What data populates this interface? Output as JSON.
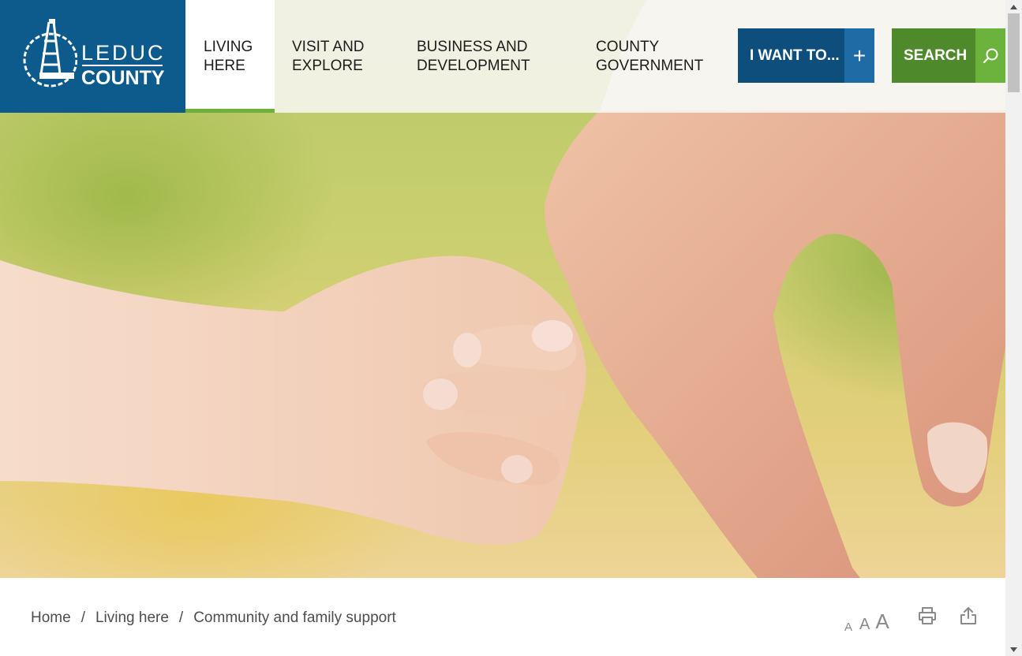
{
  "header": {
    "logo": {
      "line1": "LEDUC",
      "line2": "COUNTY"
    },
    "nav": [
      {
        "line1": "LIVING",
        "line2": "HERE",
        "active": true
      },
      {
        "line1": "VISIT AND",
        "line2": "EXPLORE",
        "active": false
      },
      {
        "line1": "BUSINESS AND",
        "line2": "DEVELOPMENT",
        "active": false
      },
      {
        "line1": "COUNTY",
        "line2": "GOVERNMENT",
        "active": false
      }
    ],
    "i_want_button": {
      "label": "I WANT TO...",
      "icon": "plus-icon"
    },
    "search_button": {
      "label": "SEARCH",
      "icon": "search-icon"
    }
  },
  "breadcrumb": {
    "items": [
      "Home",
      "Living here",
      "Community and family support"
    ],
    "separator": "/"
  },
  "tools": {
    "font_small": "A",
    "font_medium": "A",
    "font_large": "A",
    "print_icon": "print-icon",
    "share_icon": "share-icon"
  },
  "colors": {
    "brand_blue": "#0d5a8c",
    "accent_green": "#6cb33e",
    "search_green": "#4e8a2c"
  }
}
